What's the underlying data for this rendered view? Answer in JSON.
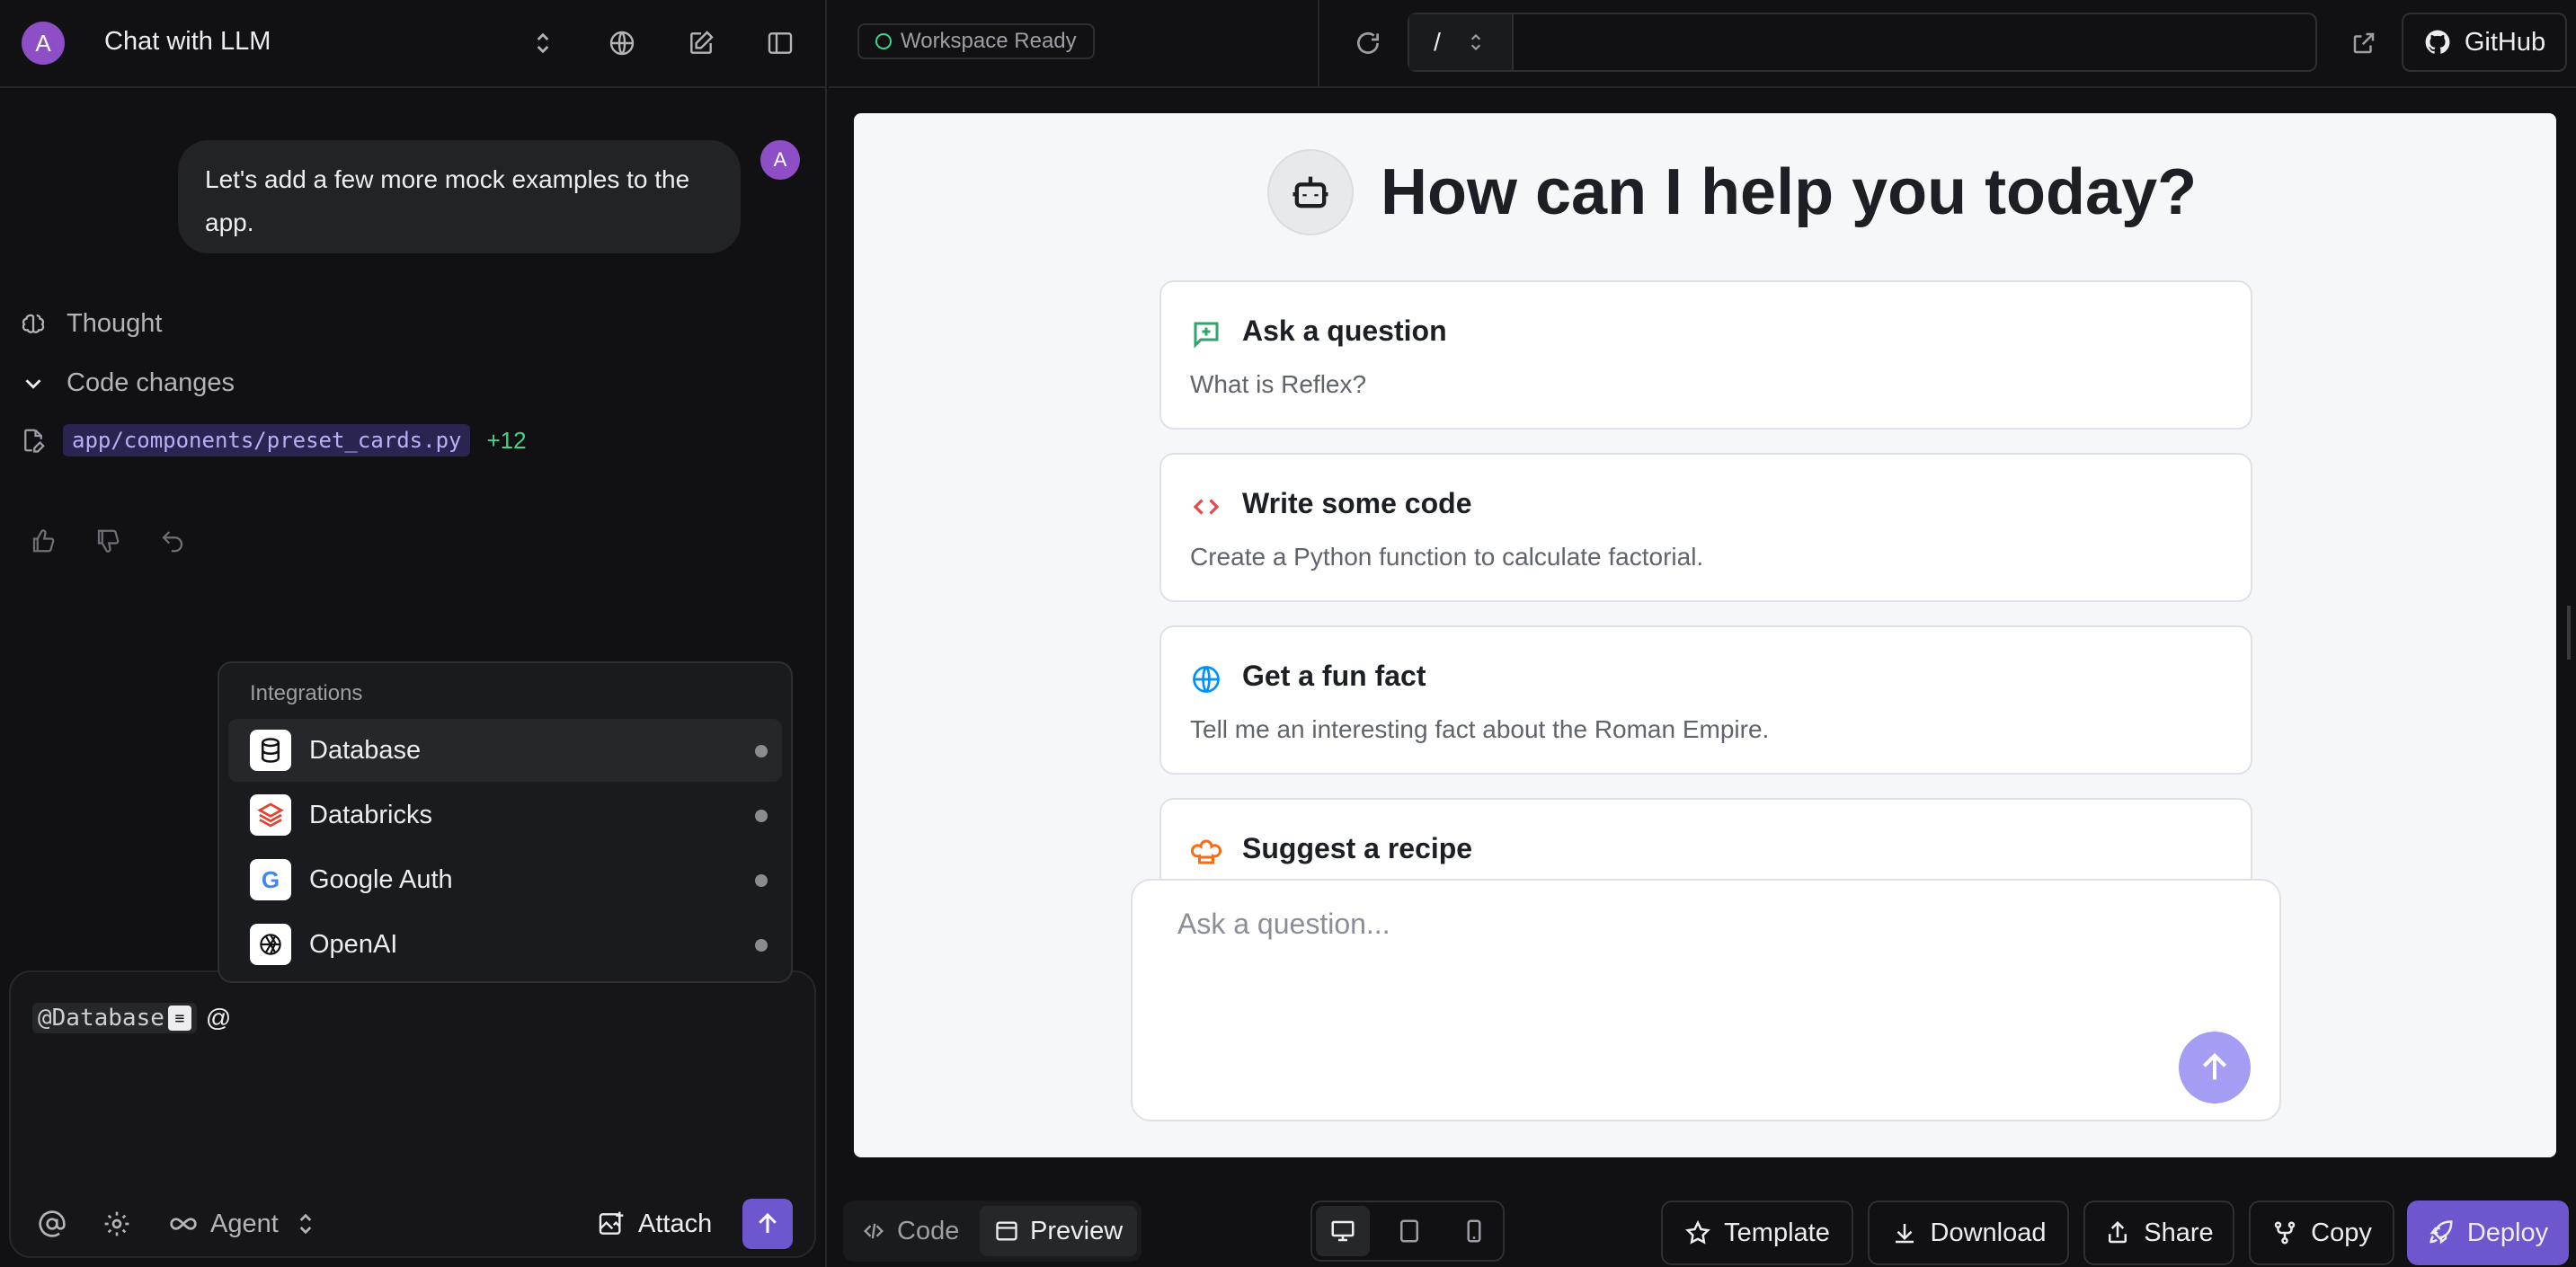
{
  "left_header": {
    "avatar": "A",
    "title": "Chat with LLM"
  },
  "chat": {
    "avatar": "A",
    "message": "Let's add a few more mock examples to the app.",
    "thought_label": "Thought",
    "code_changes_label": "Code changes",
    "file_path": "app/components/preset_cards.py",
    "file_additions": "+12"
  },
  "integrations": {
    "title": "Integrations",
    "items": [
      {
        "label": "Database",
        "icon": "database-icon"
      },
      {
        "label": "Databricks",
        "icon": "databricks-icon"
      },
      {
        "label": "Google Auth",
        "icon": "google-icon"
      },
      {
        "label": "OpenAI",
        "icon": "openai-icon"
      }
    ]
  },
  "composer": {
    "mention": "@Database",
    "trailing": "@",
    "mode_label": "Agent",
    "attach_label": "Attach"
  },
  "right_header": {
    "status": "Workspace Ready",
    "path": "/",
    "url_value": "",
    "github_label": "GitHub"
  },
  "preview": {
    "heading": "How can I help you today?",
    "cards": [
      {
        "title": "Ask a question",
        "subtitle": "What is Reflex?",
        "icon": "message-plus-icon",
        "color": "#30a46c"
      },
      {
        "title": "Write some code",
        "subtitle": "Create a Python function to calculate factorial.",
        "icon": "code-icon",
        "color": "#e5484d"
      },
      {
        "title": "Get a fun fact",
        "subtitle": "Tell me an interesting fact about the Roman Empire.",
        "icon": "globe-icon",
        "color": "#0090ff"
      },
      {
        "title": "Suggest a recipe",
        "subtitle": "",
        "icon": "chef-hat-icon",
        "color": "#f76b15"
      }
    ],
    "input_placeholder": "Ask a question..."
  },
  "bottom_bar": {
    "code_label": "Code",
    "preview_label": "Preview",
    "template_label": "Template",
    "download_label": "Download",
    "share_label": "Share",
    "copy_label": "Copy",
    "deploy_label": "Deploy"
  },
  "colors": {
    "accent": "#6e56cf",
    "avatar": "#8e4ec6",
    "success": "#3dd68c"
  }
}
